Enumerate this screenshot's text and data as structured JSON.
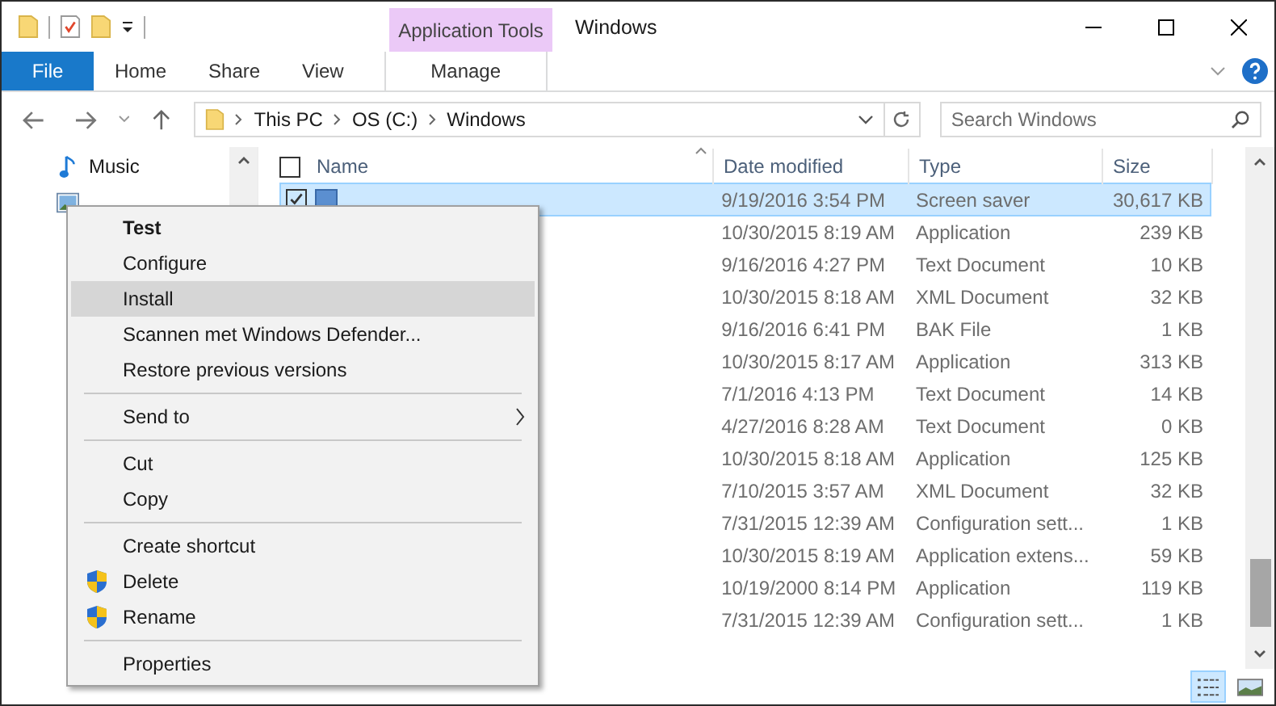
{
  "window": {
    "title": "Windows",
    "contextual_group": "Application Tools"
  },
  "ribbon_tabs": [
    {
      "label": "File",
      "kind": "file",
      "selected": false
    },
    {
      "label": "Home",
      "kind": "tab",
      "selected": false
    },
    {
      "label": "Share",
      "kind": "tab",
      "selected": false
    },
    {
      "label": "View",
      "kind": "tab",
      "selected": false
    },
    {
      "label": "Manage",
      "kind": "contextual",
      "selected": false
    }
  ],
  "address": {
    "path": [
      "This PC",
      "OS (C:)",
      "Windows"
    ]
  },
  "search": {
    "placeholder": "Search Windows"
  },
  "sidebar": {
    "items": [
      {
        "label": "Music",
        "kind": "music"
      },
      {
        "kind": "pictures"
      }
    ]
  },
  "table": {
    "select_all": {
      "checked": false
    },
    "columns": [
      "Name",
      "Date modified",
      "Type",
      "Size"
    ],
    "rows": [
      {
        "kind": "screen-saver",
        "date": "9/19/2016 3:54 PM",
        "type": "Screen saver",
        "size": "30,617 KB",
        "selected": true
      },
      {
        "date": "10/30/2015 8:19 AM",
        "type": "Application",
        "size": "239 KB",
        "selected": false
      },
      {
        "date": "9/16/2016 4:27 PM",
        "type": "Text Document",
        "size": "10 KB",
        "selected": false
      },
      {
        "date": "10/30/2015 8:18 AM",
        "type": "XML Document",
        "size": "32 KB",
        "selected": false
      },
      {
        "date": "9/16/2016 6:41 PM",
        "type": "BAK File",
        "size": "1 KB",
        "selected": false
      },
      {
        "date": "10/30/2015 8:17 AM",
        "type": "Application",
        "size": "313 KB",
        "selected": false
      },
      {
        "date": "7/1/2016 4:13 PM",
        "type": "Text Document",
        "size": "14 KB",
        "selected": false
      },
      {
        "date": "4/27/2016 8:28 AM",
        "type": "Text Document",
        "size": "0 KB",
        "selected": false
      },
      {
        "date": "10/30/2015 8:18 AM",
        "type": "Application",
        "size": "125 KB",
        "selected": false
      },
      {
        "date": "7/10/2015 3:57 AM",
        "type": "XML Document",
        "size": "32 KB",
        "selected": false
      },
      {
        "date": "7/31/2015 12:39 AM",
        "type": "Configuration sett...",
        "size": "1 KB",
        "selected": false
      },
      {
        "date": "10/30/2015 8:19 AM",
        "type": "Application extens...",
        "size": "59 KB",
        "selected": false
      },
      {
        "date": "10/19/2000 8:14 PM",
        "type": "Application",
        "size": "119 KB",
        "selected": false
      },
      {
        "date": "7/31/2015 12:39 AM",
        "type": "Configuration sett...",
        "size": "1 KB",
        "selected": false
      }
    ]
  },
  "view_buttons": [
    {
      "kind": "details",
      "selected": true
    },
    {
      "kind": "thumbnails",
      "selected": false
    }
  ],
  "context_menu": {
    "groups": [
      [
        {
          "label": "Test",
          "kind": "default",
          "selected": false
        },
        {
          "label": "Configure",
          "kind": "plain",
          "selected": false
        },
        {
          "label": "Install",
          "kind": "plain",
          "selected": true
        },
        {
          "label": "Scannen met Windows Defender...",
          "kind": "plain",
          "selected": false
        },
        {
          "label": "Restore previous versions",
          "kind": "plain",
          "selected": false
        }
      ],
      [
        {
          "label": "Send to",
          "kind": "submenu",
          "selected": false
        }
      ],
      [
        {
          "label": "Cut",
          "kind": "plain",
          "selected": false
        },
        {
          "label": "Copy",
          "kind": "plain",
          "selected": false
        }
      ],
      [
        {
          "label": "Create shortcut",
          "kind": "plain",
          "selected": false
        },
        {
          "label": "Delete",
          "kind": "elevated",
          "selected": false
        },
        {
          "label": "Rename",
          "kind": "elevated",
          "selected": false
        }
      ],
      [
        {
          "label": "Properties",
          "kind": "plain",
          "selected": false
        }
      ]
    ]
  }
}
